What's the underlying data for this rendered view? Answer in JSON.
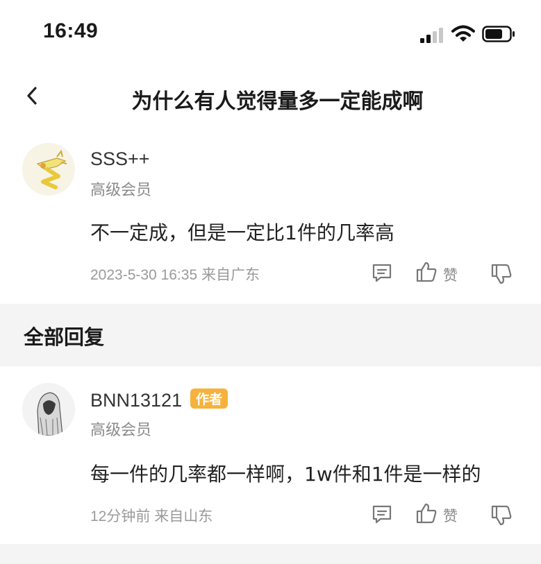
{
  "status": {
    "time": "16:49",
    "icons": [
      "cellular-signal-icon",
      "wifi-icon",
      "battery-icon"
    ]
  },
  "nav": {
    "back_icon": "chevron-left-icon",
    "title": "为什么有人觉得量多一定能成啊"
  },
  "main_post": {
    "username": "SSS++",
    "level": "高级会员",
    "content": "不一定成，但是一定比1件的几率高",
    "meta": "2023-5-30 16:35  来自广东",
    "like_label": "赞"
  },
  "replies_section": {
    "title": "全部回复"
  },
  "replies": [
    {
      "username": "BNN13121",
      "badge": "作者",
      "level": "高级会员",
      "content": "每一件的几率都一样啊，1w件和1件是一样的",
      "meta": "12分钟前  来自山东",
      "like_label": "赞"
    }
  ],
  "colors": {
    "badge": "#f6b23d",
    "gap_bg": "#f4f4f4",
    "meta_text": "#9a9a9a"
  }
}
